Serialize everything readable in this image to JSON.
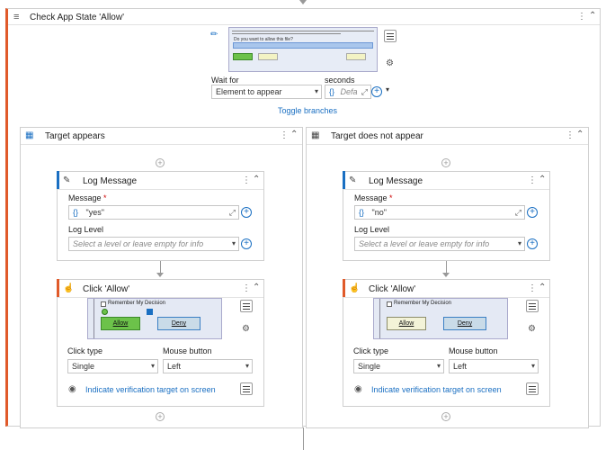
{
  "main": {
    "title": "Check App State 'Allow'",
    "wait_for_label": "Wait for",
    "wait_for_value": "Element to appear",
    "seconds_label": "seconds",
    "seconds_placeholder": "Defa",
    "toggle_branches": "Toggle branches",
    "thumb_top_text": "Do you want to allow this file?"
  },
  "branches": [
    {
      "title": "Target appears",
      "log": {
        "title": "Log Message",
        "message_label": "Message",
        "message_value": "\"yes\"",
        "level_label": "Log Level",
        "level_placeholder": "Select a level or leave empty for info"
      },
      "click": {
        "title": "Click 'Allow'",
        "remember": "Remember My Decision",
        "allow": "Allow",
        "deny": "Deny",
        "click_type_label": "Click type",
        "click_type_value": "Single",
        "mouse_button_label": "Mouse button",
        "mouse_button_value": "Left",
        "verify_link": "Indicate verification target on screen"
      }
    },
    {
      "title": "Target does not appear",
      "log": {
        "title": "Log Message",
        "message_label": "Message",
        "message_value": "\"no\"",
        "level_label": "Log Level",
        "level_placeholder": "Select a level or leave empty for info"
      },
      "click": {
        "title": "Click 'Allow'",
        "remember": "Remember My Decision",
        "allow": "Allow",
        "deny": "Deny",
        "click_type_label": "Click type",
        "click_type_value": "Single",
        "mouse_button_label": "Mouse button",
        "mouse_button_value": "Left",
        "verify_link": "Indicate verification target on screen"
      }
    }
  ],
  "colors": {
    "accent": "#1a6fc2",
    "activity_stripe": "#e05a2a",
    "log_stripe": "#1a6fc2"
  }
}
